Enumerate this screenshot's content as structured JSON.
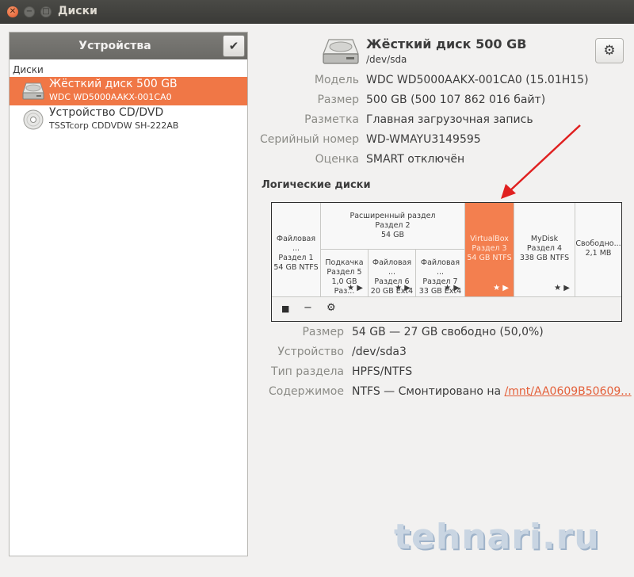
{
  "window": {
    "title": "Диски"
  },
  "sidebar": {
    "header": "Устройства",
    "group_label": "Диски",
    "devices": [
      {
        "name": "Жёсткий диск 500 GB",
        "sub": "WDC WD5000AAKX-001CA0",
        "icon": "hard-disk-icon",
        "selected": true
      },
      {
        "name": "Устройство CD/DVD",
        "sub": "TSSTcorp CDDVDW SH-222AB",
        "icon": "optical-disc-icon",
        "selected": false
      }
    ]
  },
  "disk": {
    "title": "Жёсткий диск 500 GB",
    "path": "/dev/sda",
    "properties": [
      {
        "label": "Модель",
        "value": "WDC WD5000AAKX-001CA0 (15.01H15)"
      },
      {
        "label": "Размер",
        "value": "500 GB (500 107 862 016 байт)"
      },
      {
        "label": "Разметка",
        "value": "Главная загрузочная запись"
      },
      {
        "label": "Серийный номер",
        "value": "WD-WMAYU3149595"
      },
      {
        "label": "Оценка",
        "value": "SMART отключён"
      }
    ]
  },
  "volumes": {
    "title": "Логические диски",
    "partitions": {
      "p1": [
        "Файловая ...",
        "Раздел 1",
        "54 GB NTFS"
      ],
      "ext": [
        "Расширенный раздел",
        "Раздел 2",
        "54 GB"
      ],
      "p5": [
        "Подкачка",
        "Раздел 5",
        "1,0 GB Раз..."
      ],
      "p6": [
        "Файловая ...",
        "Раздел 6",
        "20 GB Ext4"
      ],
      "p7": [
        "Файловая ...",
        "Раздел 7",
        "33 GB Ext4"
      ],
      "p3": [
        "VirtualBox",
        "Раздел 3",
        "54 GB NTFS"
      ],
      "p4": [
        "MyDisk",
        "Раздел 4",
        "338 GB NTFS"
      ],
      "free": [
        "Свободно...",
        "2,1 MB"
      ]
    },
    "marks": "★ ▶",
    "toolbar": {
      "stop": "■",
      "remove": "−",
      "settings": "⚙"
    }
  },
  "selected_volume": {
    "properties": [
      {
        "label": "Размер",
        "value": "54 GB — 27 GB свободно (50,0%)"
      },
      {
        "label": "Устройство",
        "value": "/dev/sda3"
      },
      {
        "label": "Тип раздела",
        "value": "HPFS/NTFS"
      }
    ],
    "contents_label": "Содержимое",
    "contents_prefix": "NTFS — Смонтировано на ",
    "contents_link": "/mnt/AA0609B50609..."
  },
  "watermark": "tehnari.ru",
  "colors": {
    "accent": "#f07746",
    "link": "#e4603a",
    "arrow": "#e02020"
  }
}
